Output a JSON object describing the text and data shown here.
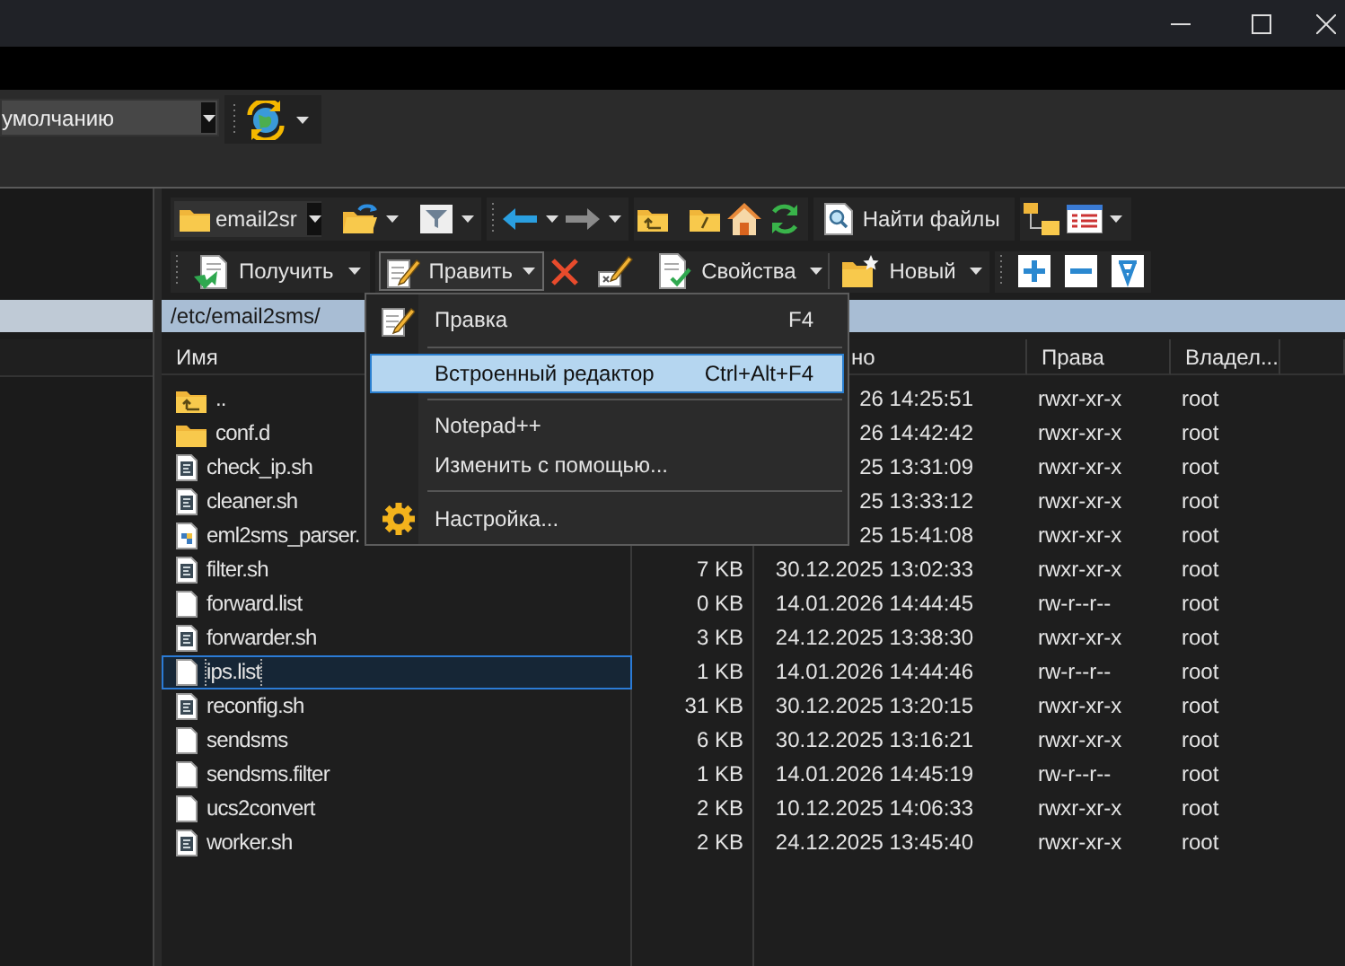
{
  "top_toolbar": {
    "profile_combo": {
      "value": "умолчанию"
    }
  },
  "toolbar_1": {
    "location_combo": {
      "value": "email2sr"
    },
    "find_button": {
      "label": "Найти файлы"
    }
  },
  "toolbar_2": {
    "buttons": [
      {
        "label": "Получить",
        "pressed": false
      },
      {
        "label": "Править",
        "pressed": true
      },
      {
        "label": "Свойства",
        "pressed": false
      },
      {
        "label": "Новый",
        "pressed": false
      }
    ]
  },
  "path_bar": {
    "path": "/etc/email2sms/"
  },
  "file_list": {
    "columns": {
      "name": "Имя",
      "changed": "но",
      "rights": "Права",
      "owner": "Владел..."
    },
    "rows": [
      {
        "kind": "parent",
        "name": "..",
        "changed": "26 14:25:51",
        "rights": "rwxr-xr-x",
        "owner": "root",
        "focused": false
      },
      {
        "kind": "folder",
        "name": "conf.d",
        "changed": "26 14:42:42",
        "rights": "rwxr-xr-x",
        "owner": "root",
        "focused": false
      },
      {
        "kind": "script",
        "name": "check_ip.sh",
        "changed": "25 13:31:09",
        "rights": "rwxr-xr-x",
        "owner": "root",
        "focused": false
      },
      {
        "kind": "script",
        "name": "cleaner.sh",
        "changed": "25 13:33:12",
        "rights": "rwxr-xr-x",
        "owner": "root",
        "focused": false
      },
      {
        "kind": "python",
        "name": "eml2sms_parser.",
        "changed": "25 15:41:08",
        "rights": "rwxr-xr-x",
        "owner": "root",
        "focused": false
      },
      {
        "kind": "script",
        "name": "filter.sh",
        "size": "7 KB",
        "changed": "30.12.2025 13:02:33",
        "rights": "rwxr-xr-x",
        "owner": "root",
        "focused": false
      },
      {
        "kind": "file",
        "name": "forward.list",
        "size": "0 KB",
        "changed": "14.01.2026 14:44:45",
        "rights": "rw-r--r--",
        "owner": "root",
        "focused": false
      },
      {
        "kind": "script",
        "name": "forwarder.sh",
        "size": "3 KB",
        "changed": "24.12.2025 13:38:30",
        "rights": "rwxr-xr-x",
        "owner": "root",
        "focused": false
      },
      {
        "kind": "file",
        "name": "ips.list",
        "size": "1 KB",
        "changed": "14.01.2026 14:44:46",
        "rights": "rw-r--r--",
        "owner": "root",
        "focused": true
      },
      {
        "kind": "script",
        "name": "reconfig.sh",
        "size": "31 KB",
        "changed": "30.12.2025 13:20:15",
        "rights": "rwxr-xr-x",
        "owner": "root",
        "focused": false
      },
      {
        "kind": "file",
        "name": "sendsms",
        "size": "6 KB",
        "changed": "30.12.2025 13:16:21",
        "rights": "rwxr-xr-x",
        "owner": "root",
        "focused": false
      },
      {
        "kind": "file",
        "name": "sendsms.filter",
        "size": "1 KB",
        "changed": "14.01.2026 14:45:19",
        "rights": "rw-r--r--",
        "owner": "root",
        "focused": false
      },
      {
        "kind": "file",
        "name": "ucs2convert",
        "size": "2 KB",
        "changed": "10.12.2025 14:06:33",
        "rights": "rwxr-xr-x",
        "owner": "root",
        "focused": false
      },
      {
        "kind": "script",
        "name": "worker.sh",
        "size": "2 KB",
        "changed": "24.12.2025 13:45:40",
        "rights": "rwxr-xr-x",
        "owner": "root",
        "focused": false
      }
    ]
  },
  "context_menu": {
    "items": [
      {
        "kind": "edit",
        "label": "Правка",
        "shortcut": "F4",
        "selected": false
      },
      {
        "kind": "separator"
      },
      {
        "kind": "plain",
        "label": "Встроенный редактор",
        "shortcut": "Ctrl+Alt+F4",
        "selected": true
      },
      {
        "kind": "separator"
      },
      {
        "kind": "plain",
        "label": "Notepad++",
        "selected": false
      },
      {
        "kind": "plain",
        "label": "Изменить с помощью...",
        "selected": false
      },
      {
        "kind": "separator"
      },
      {
        "kind": "settings",
        "label": "Настройка...",
        "selected": false
      }
    ]
  }
}
